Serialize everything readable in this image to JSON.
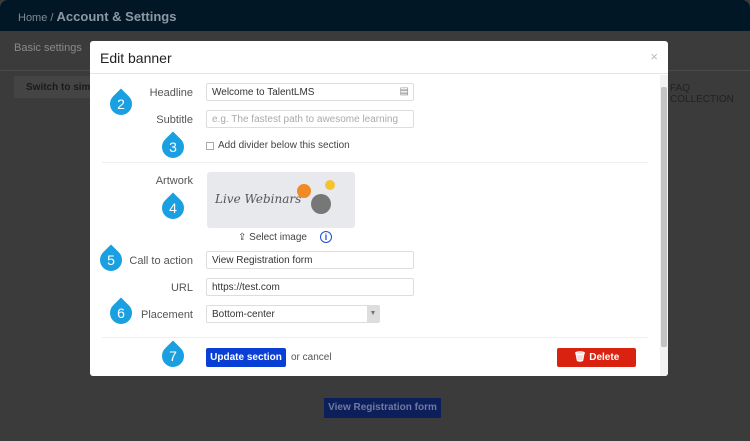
{
  "background": {
    "breadcrumb_home": "Home /",
    "breadcrumb_current": "Account & Settings",
    "tab_basic": "Basic settings",
    "switch_label": "Switch to simple",
    "right_links": "FAQ COLLECTION",
    "cta_button": "View Registration form"
  },
  "modal": {
    "title": "Edit banner",
    "close": "×",
    "headline": {
      "label": "Headline",
      "value": "Welcome to TalentLMS"
    },
    "subtitle": {
      "label": "Subtitle",
      "placeholder": "e.g. The fastest path to awesome learning"
    },
    "divider": {
      "label": "Add divider below this section",
      "checked": false
    },
    "artwork": {
      "label": "Artwork",
      "image_text": "Live Webinars",
      "select_label": "Select image"
    },
    "cta": {
      "label": "Call to action",
      "value": "View Registration form"
    },
    "url": {
      "label": "URL",
      "value": "https://test.com"
    },
    "placement": {
      "label": "Placement",
      "value": "Bottom-center"
    },
    "update_label": "Update section",
    "cancel_label": "or cancel",
    "delete_label": "Delete",
    "colors": {
      "primary": "#0a3fd6",
      "danger": "#d9220f",
      "badge": "#1aa0e0"
    }
  },
  "badges": [
    "2",
    "3",
    "4",
    "5",
    "6",
    "7"
  ]
}
